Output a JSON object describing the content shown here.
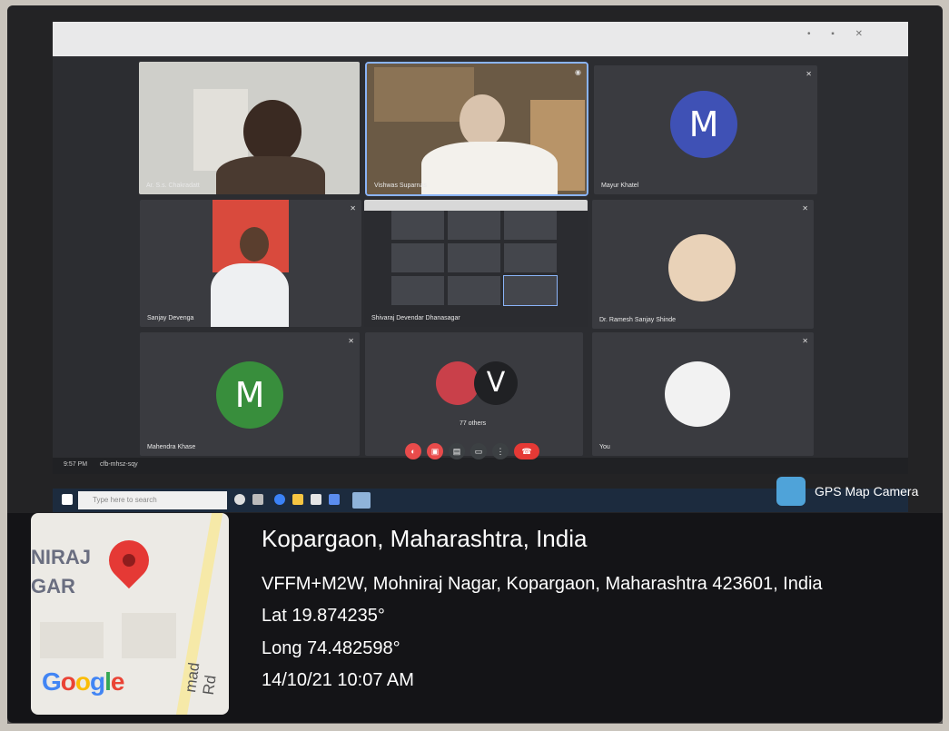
{
  "meeting": {
    "tiles": [
      {
        "name": "Ar. S.s. Chakradatt",
        "type": "video"
      },
      {
        "name": "Vishwas Suparnas",
        "type": "video",
        "active": true
      },
      {
        "name": "Mayur Khatel",
        "type": "avatar",
        "initial": "M",
        "color": "#3f51b5"
      },
      {
        "name": "Sanjay Devenga",
        "type": "video"
      },
      {
        "name": "Shivaraj Devendar Dhanasagar",
        "type": "screen"
      },
      {
        "name": "Dr. Ramesh Sanjay Shinde",
        "type": "photo"
      },
      {
        "name": "Mahendra Khase",
        "type": "avatar",
        "initial": "M",
        "color": "#388e3c"
      },
      {
        "name": "77 others",
        "type": "group",
        "initial": "V"
      },
      {
        "name": "You",
        "type": "photo"
      }
    ],
    "clock": "9:57 PM",
    "meeting_code": "cfb-mhsz-sqy"
  },
  "taskbar": {
    "search_placeholder": "Type here to search"
  },
  "gps": {
    "app_name": "GPS Map Camera",
    "location_title": "Kopargaon, Maharashtra, India",
    "address": "VFFM+M2W, Mohniraj Nagar, Kopargaon, Maharashtra 423601, India",
    "lat": "Lat 19.874235°",
    "long": "Long 74.482598°",
    "datetime": "14/10/21 10:07 AM"
  },
  "map": {
    "label_line1": "NIRAJ",
    "label_line2": "GAR",
    "road": "mad Rd",
    "brand": "Google"
  },
  "colors": {
    "end_call": "#e53935",
    "control_red": "#e84b4b",
    "tile_bg": "#3a3b40"
  }
}
